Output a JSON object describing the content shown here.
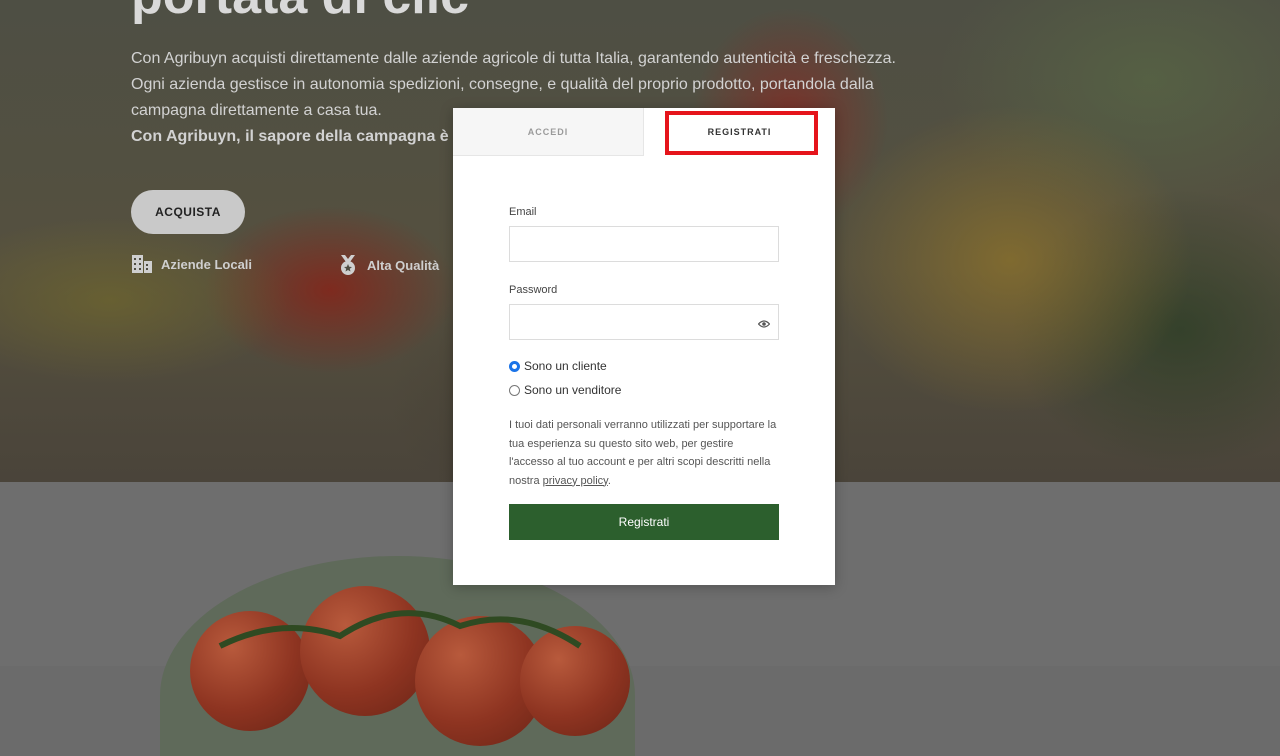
{
  "hero": {
    "title": "portata di clic",
    "paragraph": "Con Agribuyn acquisti direttamente dalle aziende agricole di tutta Italia, garantendo autenticità e freschezza. Ogni azienda gestisce in autonomia spedizioni, consegne, e qualità del proprio prodotto, portandola dalla campagna direttamente a casa tua.",
    "tagline": "Con Agribuyn, il sapore della campagna è a",
    "cta_label": "ACQUISTA",
    "features": [
      {
        "label": "Aziende Locali",
        "icon": "building-icon"
      },
      {
        "label": "Alta Qualità",
        "icon": "medal-icon"
      }
    ]
  },
  "modal": {
    "tabs": [
      {
        "label": "ACCEDI",
        "active": false
      },
      {
        "label": "REGISTRATI",
        "active": true
      }
    ],
    "email_label": "Email",
    "email_value": "",
    "password_label": "Password",
    "password_value": "",
    "password_toggle_icon": "eye-icon",
    "role_options": [
      {
        "label": "Sono un cliente",
        "checked": true
      },
      {
        "label": "Sono un venditore",
        "checked": false
      }
    ],
    "privacy_text": "I tuoi dati personali verranno utilizzati per supportare la tua esperienza su questo sito web, per gestire l'accesso al tuo account e per altri scopi descritti nella nostra",
    "privacy_link": "privacy policy",
    "privacy_end": ".",
    "submit_label": "Registrati"
  },
  "colors": {
    "submit_bg": "#2c5f2d",
    "highlight": "#e5141b",
    "radio_checked": "#1a73e8"
  }
}
